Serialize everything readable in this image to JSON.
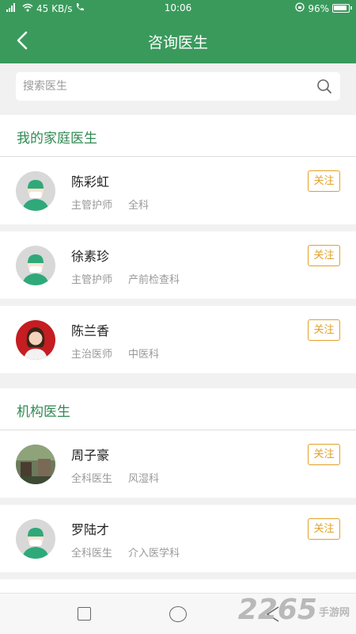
{
  "status_bar": {
    "signal": "4G",
    "net_speed": "45 KB/s",
    "time": "10:06",
    "battery": "96%"
  },
  "header": {
    "title": "咨询医生"
  },
  "search": {
    "placeholder": "搜索医生"
  },
  "sections": [
    {
      "title": "我的家庭医生",
      "doctors": [
        {
          "name": "陈彩虹",
          "title": "主管护师",
          "dept": "全科",
          "follow_label": "关注",
          "avatar": "default-nurse-avatar"
        },
        {
          "name": "徐素珍",
          "title": "主管护师",
          "dept": "产前检查科",
          "follow_label": "关注",
          "avatar": "default-nurse-avatar"
        },
        {
          "name": "陈兰香",
          "title": "主治医师",
          "dept": "中医科",
          "follow_label": "关注",
          "avatar": "photo-avatar"
        }
      ]
    },
    {
      "title": "机构医生",
      "doctors": [
        {
          "name": "周子豪",
          "title": "全科医生",
          "dept": "风湿科",
          "follow_label": "关注",
          "avatar": "photo-avatar"
        },
        {
          "name": "罗陆才",
          "title": "全科医生",
          "dept": "介入医学科",
          "follow_label": "关注",
          "avatar": "default-nurse-avatar"
        }
      ]
    }
  ],
  "watermark": {
    "brand": "2265",
    "site": "手游网"
  },
  "colors": {
    "brand_green": "#3a9a5c",
    "section_title": "#2f8a52",
    "follow_orange": "#e0a12a"
  }
}
